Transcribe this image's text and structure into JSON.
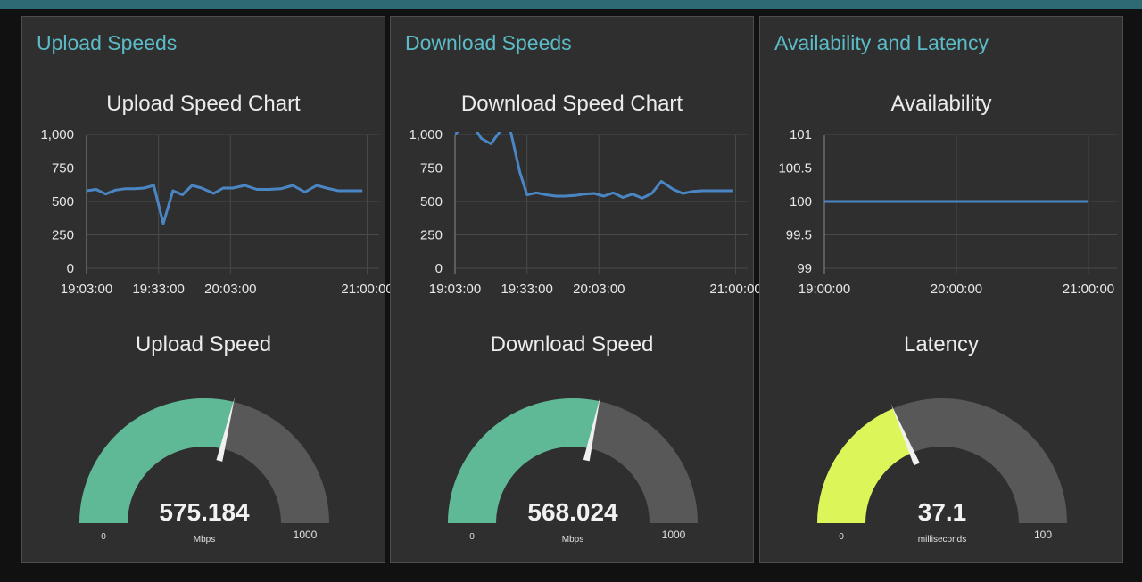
{
  "panels": [
    {
      "title": "Upload Speeds",
      "chart_title": "Upload Speed Chart",
      "gauge": {
        "title": "Upload Speed",
        "value": 575.184,
        "value_text": "575.184",
        "units": "Mbps",
        "min": 0,
        "max": 1000,
        "min_text": "0",
        "max_text": "1000",
        "color": "#5fb896"
      }
    },
    {
      "title": "Download Speeds",
      "chart_title": "Download Speed Chart",
      "gauge": {
        "title": "Download Speed",
        "value": 568.024,
        "value_text": "568.024",
        "units": "Mbps",
        "min": 0,
        "max": 1000,
        "min_text": "0",
        "max_text": "1000",
        "color": "#5fb896"
      }
    },
    {
      "title": "Availability and Latency",
      "chart_title": "Availability",
      "gauge": {
        "title": "Latency",
        "value": 37.1,
        "value_text": "37.1",
        "units": "milliseconds",
        "min": 0,
        "max": 100,
        "min_text": "0",
        "max_text": "100",
        "color": "#dcf65a"
      }
    }
  ],
  "colors": {
    "line": "#4b86c4",
    "grid": "#4a4a4a",
    "gauge_track": "#585858",
    "needle": "#f0f0f0",
    "title": "#5bbcc7",
    "background": "#2f2f2f"
  },
  "chart_data": [
    {
      "type": "line",
      "title": "Upload Speed Chart",
      "ylim": [
        0,
        1000
      ],
      "ytick_labels": [
        "0",
        "250",
        "500",
        "750",
        "1,000"
      ],
      "yticks": [
        0,
        250,
        500,
        750,
        1000
      ],
      "xlim": [
        "19:03:00",
        "21:05:00"
      ],
      "xtick_labels": [
        "19:03:00",
        "19:33:00",
        "20:03:00",
        "21:00:00"
      ],
      "xticks": [
        "19:03:00",
        "19:33:00",
        "20:03:00",
        "21:00:00"
      ],
      "grid": true,
      "series": [
        {
          "x": [
            "19:03:00",
            "19:07:00",
            "19:11:00",
            "19:15:00",
            "19:19:00",
            "19:23:00",
            "19:27:00",
            "19:31:00",
            "19:35:00",
            "19:39:00",
            "19:43:00",
            "19:47:00",
            "19:51:00",
            "19:56:00",
            "20:00:00",
            "20:04:00",
            "20:09:00",
            "20:14:00",
            "20:19:00",
            "20:24:00",
            "20:29:00",
            "20:34:00",
            "20:39:00",
            "20:43:00",
            "20:48:00",
            "20:53:00",
            "20:58:00"
          ],
          "y": [
            580,
            590,
            555,
            585,
            595,
            595,
            600,
            620,
            335,
            580,
            550,
            620,
            600,
            560,
            600,
            600,
            620,
            590,
            590,
            595,
            620,
            570,
            620,
            600,
            580,
            580,
            580
          ]
        }
      ]
    },
    {
      "type": "line",
      "title": "Download Speed Chart",
      "ylim": [
        0,
        1000
      ],
      "ytick_labels": [
        "0",
        "250",
        "500",
        "750",
        "1,000"
      ],
      "yticks": [
        0,
        250,
        500,
        750,
        1000
      ],
      "xlim": [
        "19:03:00",
        "21:05:00"
      ],
      "xtick_labels": [
        "19:03:00",
        "19:33:00",
        "20:03:00",
        "21:00:00"
      ],
      "xticks": [
        "19:03:00",
        "19:33:00",
        "20:03:00",
        "21:00:00"
      ],
      "grid": true,
      "series": [
        {
          "x": [
            "19:03:00",
            "19:06:00",
            "19:10:00",
            "19:14:00",
            "19:18:00",
            "19:22:00",
            "19:26:00",
            "19:30:00",
            "19:33:00",
            "19:37:00",
            "19:41:00",
            "19:45:00",
            "19:49:00",
            "19:53:00",
            "19:57:00",
            "20:01:00",
            "20:05:00",
            "20:09:00",
            "20:13:00",
            "20:17:00",
            "20:21:00",
            "20:25:00",
            "20:29:00",
            "20:34:00",
            "20:38:00",
            "20:42:00",
            "20:46:00",
            "20:51:00",
            "20:55:00",
            "20:59:00"
          ],
          "y": [
            1000,
            1060,
            1080,
            970,
            930,
            1030,
            1040,
            720,
            550,
            565,
            550,
            540,
            540,
            545,
            555,
            560,
            540,
            565,
            530,
            555,
            525,
            560,
            650,
            590,
            560,
            575,
            580,
            580,
            580,
            580
          ]
        }
      ]
    },
    {
      "type": "line",
      "title": "Availability",
      "ylim": [
        99,
        101
      ],
      "ytick_labels": [
        "99",
        "99.5",
        "100",
        "100.5",
        "101"
      ],
      "yticks": [
        99,
        99.5,
        100,
        100.5,
        101
      ],
      "xlim": [
        "19:00:00",
        "21:13:00"
      ],
      "xtick_labels": [
        "19:00:00",
        "20:00:00",
        "21:00:00"
      ],
      "xticks": [
        "19:00:00",
        "20:00:00",
        "21:00:00"
      ],
      "grid": true,
      "series": [
        {
          "x": [
            "19:00:00",
            "21:00:00"
          ],
          "y": [
            100,
            100
          ]
        }
      ]
    }
  ]
}
